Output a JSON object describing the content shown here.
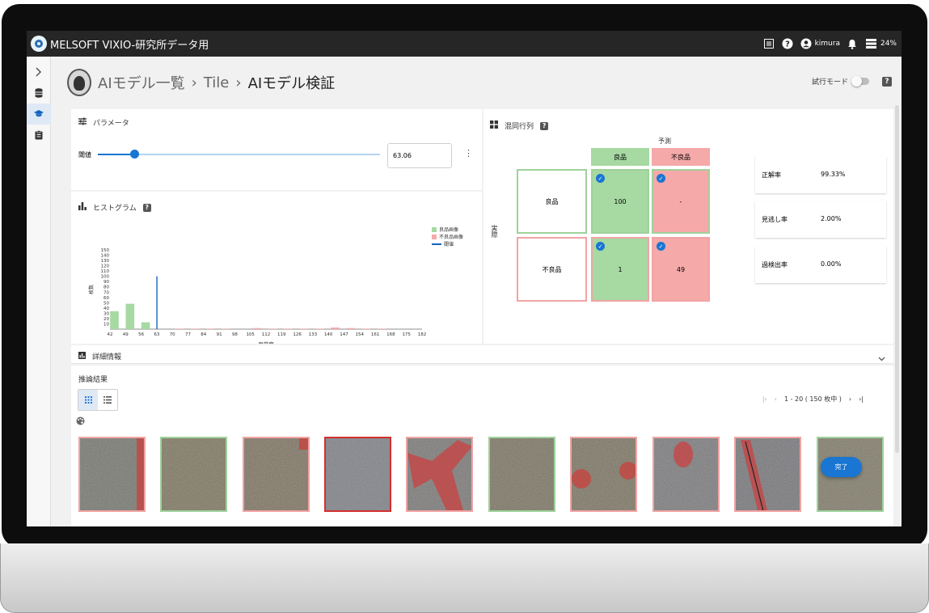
{
  "app": {
    "title": "MELSOFT VIXIO-研究所データ用",
    "user": "kimura",
    "battery": "24%"
  },
  "breadcrumb": [
    "AIモデル一覧",
    "Tile",
    "AIモデル検証"
  ],
  "trial_mode": {
    "label": "試行モード",
    "enabled": false
  },
  "parameters": {
    "title": "パラメータ",
    "threshold_label": "閾値",
    "threshold_value": "63.06",
    "threshold_fraction": 0.13
  },
  "histogram": {
    "title": "ヒストグラム",
    "ylabel": "枚数",
    "xlabel": "異常度",
    "legend": [
      "良品画像",
      "不良品画像",
      "閾値"
    ],
    "colors": {
      "good": "#a7d9a3",
      "bad": "#f5a9a9",
      "threshold": "#1565c0"
    }
  },
  "chart_data": {
    "type": "bar",
    "xlabel": "異常度",
    "ylabel": "枚数",
    "x_ticks": [
      "42",
      "49",
      "56",
      "63",
      "70",
      "77",
      "84",
      "91",
      "98",
      "105",
      "112",
      "119",
      "126",
      "133",
      "140",
      "147",
      "154",
      "161",
      "168",
      "175",
      "182"
    ],
    "y_ticks": [
      "10",
      "20",
      "30",
      "40",
      "50",
      "60",
      "70",
      "80",
      "90",
      "100",
      "110",
      "120",
      "130",
      "140",
      "150"
    ],
    "ylim": [
      0,
      150
    ],
    "xlim": [
      42,
      182
    ],
    "series": [
      {
        "name": "良品画像",
        "points": [
          [
            44,
            34
          ],
          [
            51,
            48
          ],
          [
            58,
            13
          ]
        ]
      },
      {
        "name": "不良品画像",
        "points": [
          [
            73,
            1
          ],
          [
            80,
            1
          ],
          [
            87,
            1
          ],
          [
            94,
            1
          ],
          [
            108,
            2
          ],
          [
            115,
            1
          ],
          [
            122,
            1
          ],
          [
            129,
            1
          ],
          [
            136,
            1
          ],
          [
            143,
            3
          ],
          [
            150,
            2
          ],
          [
            157,
            1
          ],
          [
            164,
            1
          ]
        ]
      }
    ],
    "threshold": 63.06
  },
  "confusion": {
    "title": "混同行列",
    "predicted_label": "予測",
    "actual_label": "実際",
    "columns": [
      "良品",
      "不良品"
    ],
    "rows": [
      "良品",
      "不良品"
    ],
    "cells": [
      [
        "100",
        "-"
      ],
      [
        "1",
        "49"
      ]
    ]
  },
  "metrics": [
    {
      "label": "正解率",
      "value": "99.33%"
    },
    {
      "label": "見逃し率",
      "value": "2.00%"
    },
    {
      "label": "過検出率",
      "value": "0.00%"
    }
  ],
  "details": {
    "title": "詳細情報"
  },
  "results": {
    "title": "推論結果",
    "pager": "1 - 20 ( 150 枚中 )",
    "done_label": "完了",
    "thumbs": [
      {
        "status": "bad",
        "defect": "edge"
      },
      {
        "status": "good",
        "defect": "none"
      },
      {
        "status": "bad",
        "defect": "corner"
      },
      {
        "status": "selected",
        "defect": "none"
      },
      {
        "status": "bad",
        "defect": "streak"
      },
      {
        "status": "good",
        "defect": "none"
      },
      {
        "status": "bad",
        "defect": "spots"
      },
      {
        "status": "bad",
        "defect": "blob"
      },
      {
        "status": "bad",
        "defect": "crack"
      },
      {
        "status": "good",
        "defect": "none"
      }
    ]
  }
}
